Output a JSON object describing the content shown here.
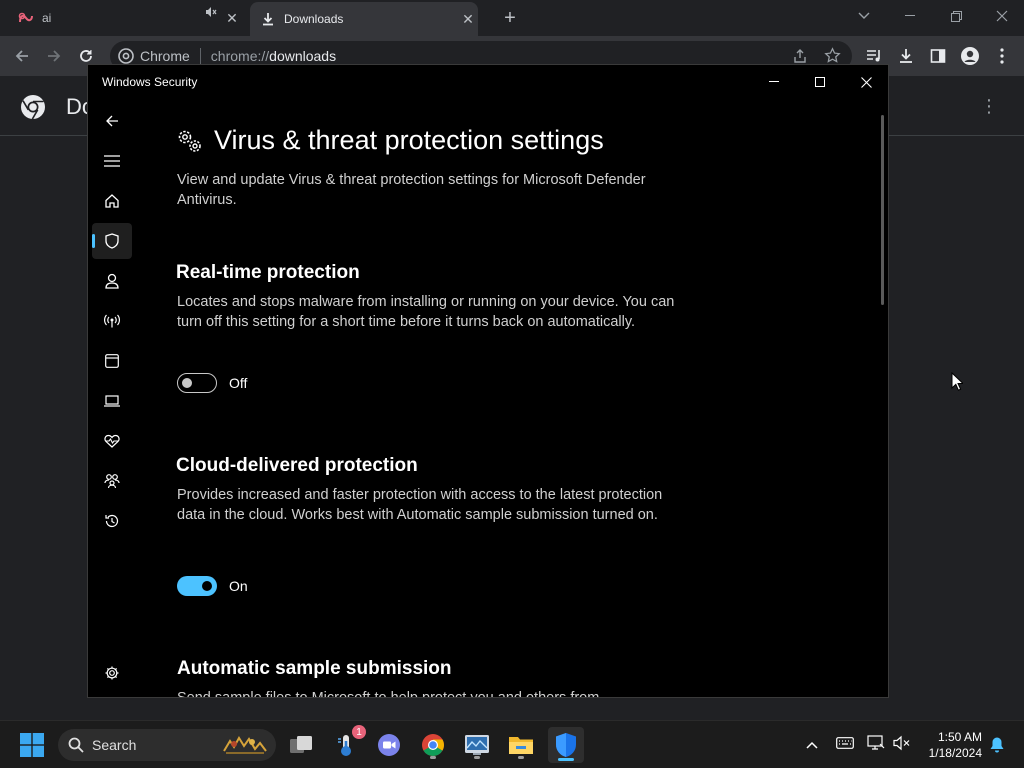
{
  "browser": {
    "tabs": [
      {
        "label": "ai",
        "active": false
      },
      {
        "label": "Downloads",
        "active": true
      }
    ],
    "omnibox": {
      "site_label": "Chrome",
      "url_scheme": "chrome://",
      "url_host": "downloads"
    },
    "page_title": "Do"
  },
  "security_window": {
    "title": "Windows Security",
    "page": {
      "heading": "Virus & threat protection settings",
      "intro": "View and update Virus & threat protection settings for Microsoft Defender Antivirus.",
      "sections": [
        {
          "title": "Real-time protection",
          "description": "Locates and stops malware from installing or running on your device. You can turn off this setting for a short time before it turns back on automatically.",
          "toggle_state": "Off"
        },
        {
          "title": "Cloud-delivered protection",
          "description": "Provides increased and faster protection with access to the latest protection data in the cloud. Works best with Automatic sample submission turned on.",
          "toggle_state": "On"
        },
        {
          "title": "Automatic sample submission",
          "description": "Send sample files to Microsoft to help protect you and others from"
        }
      ]
    },
    "accent_color": "#4cc2ff"
  },
  "taskbar": {
    "search_label": "Search",
    "teams_badge": "1",
    "time": "1:50 AM",
    "date": "1/18/2024"
  }
}
